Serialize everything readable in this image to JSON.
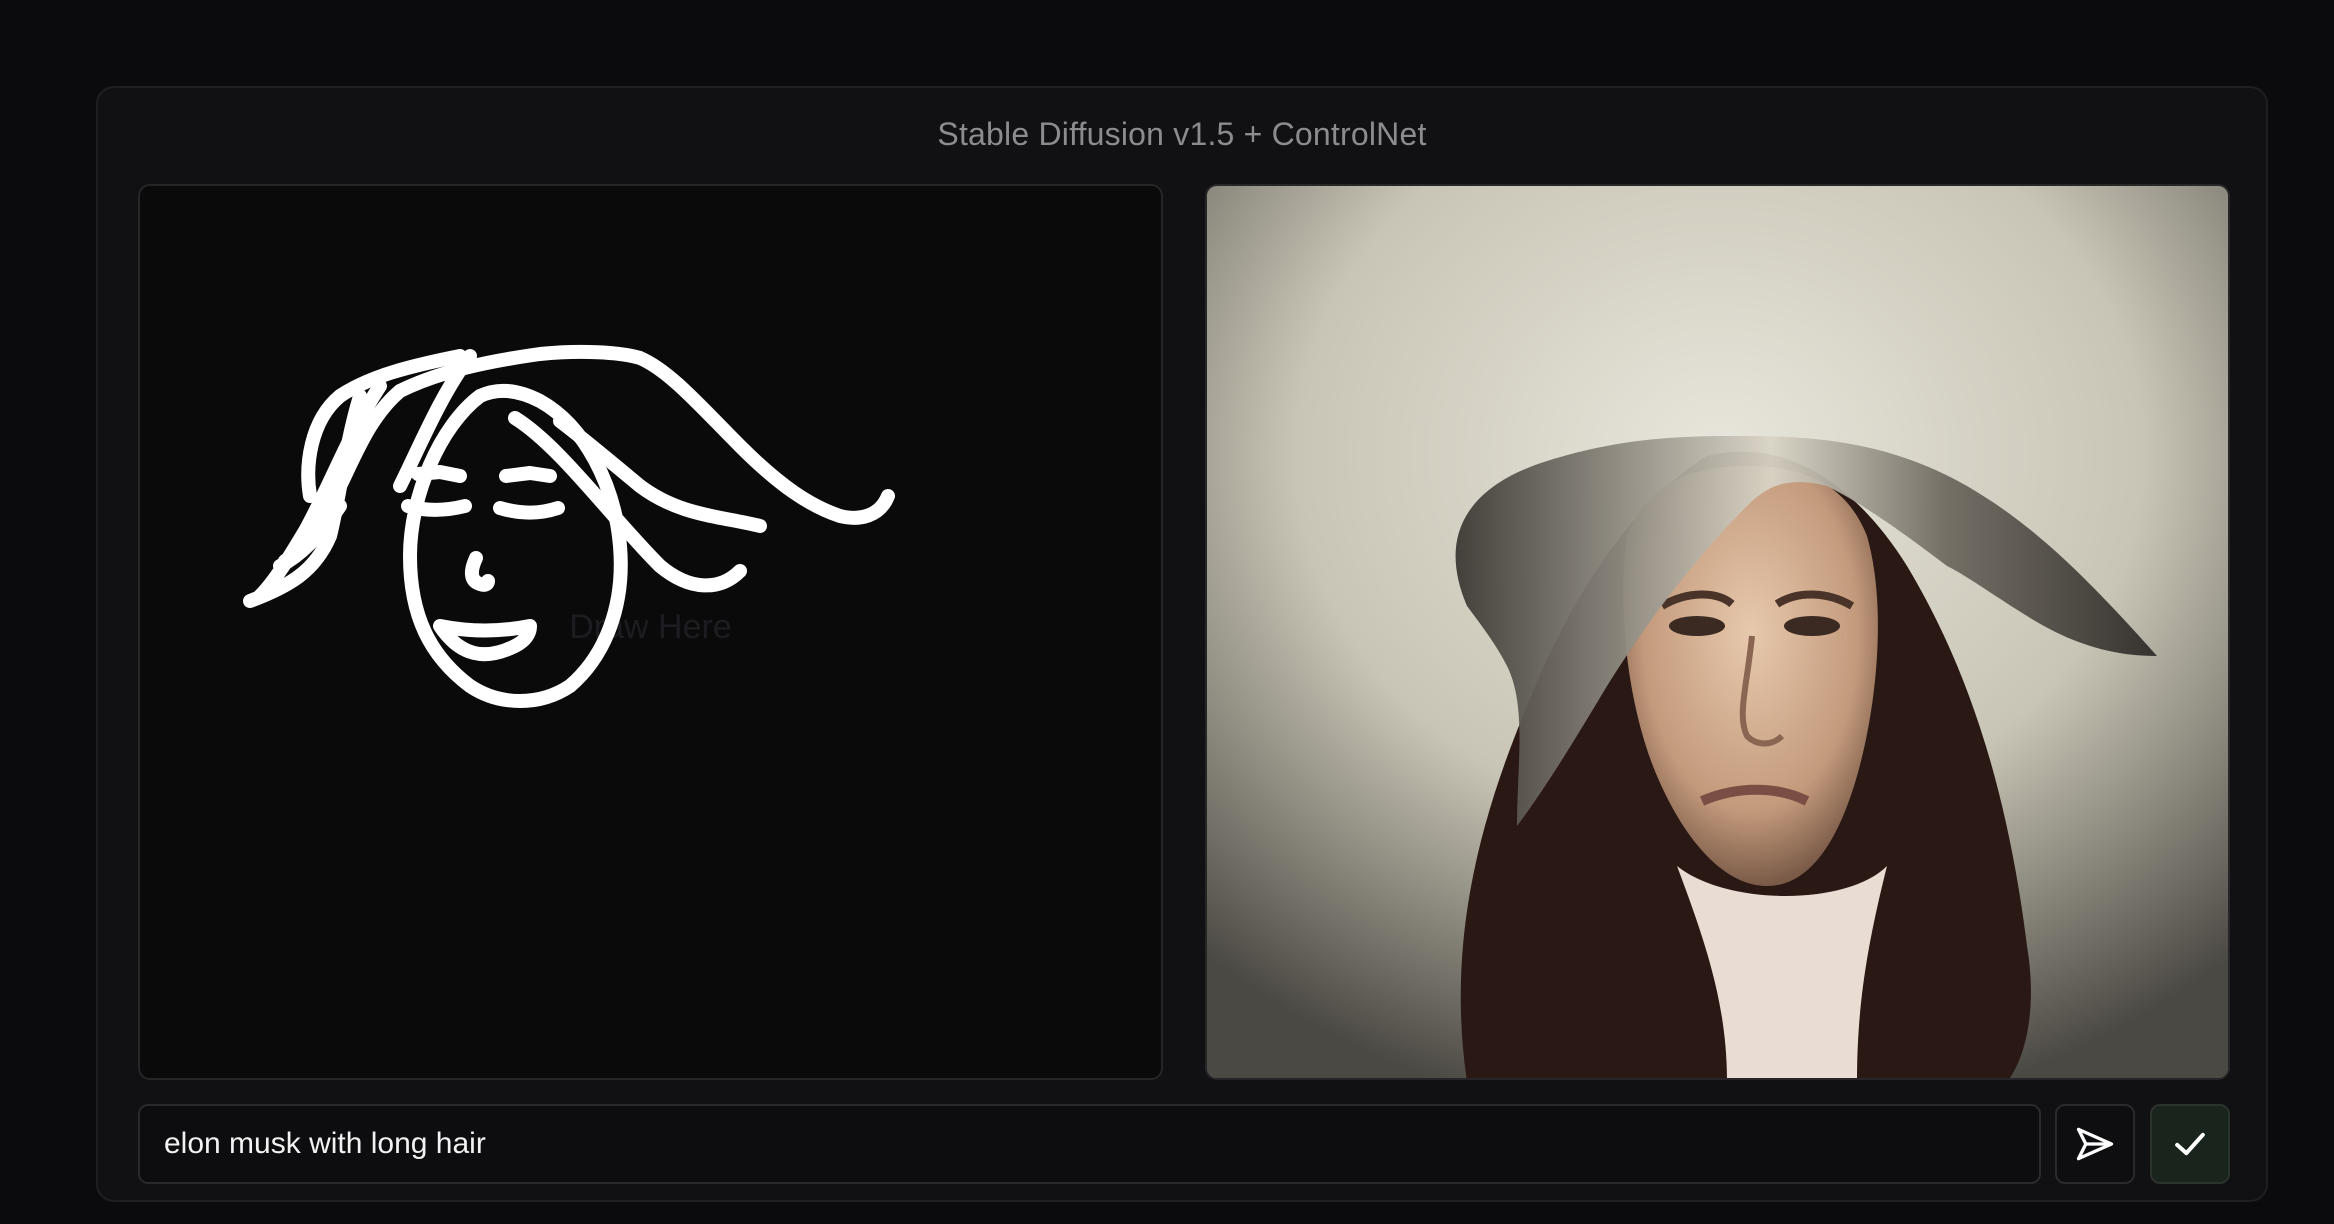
{
  "app": {
    "title": "Stable Diffusion v1.5 + ControlNet"
  },
  "canvas": {
    "hint": "Draw Here"
  },
  "prompt": {
    "value": "elon musk with long hair"
  },
  "buttons": {
    "send_icon": "send-arrow-icon",
    "accept_icon": "checkmark-icon"
  },
  "colors": {
    "background": "#0b0b0d",
    "panel": "#111113",
    "stroke": "#ffffff",
    "accept": "#19241c"
  }
}
